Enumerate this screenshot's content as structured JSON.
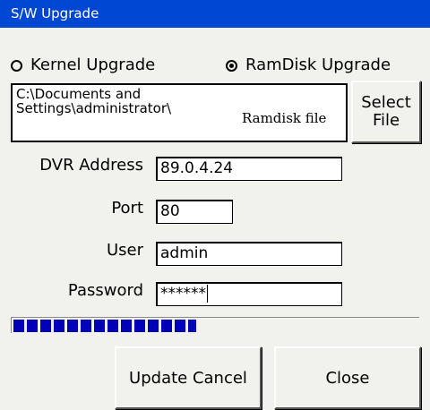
{
  "window": {
    "title": "S/W Upgrade"
  },
  "upgrade_type": {
    "kernel_label": "Kernel Upgrade",
    "ramdisk_label": "RamDisk Upgrade",
    "selected": "RamDisk Upgrade"
  },
  "file": {
    "path": "C:\\Documents and\nSettings\\administrator\\",
    "caption": "Ramdisk file",
    "select_label": "Select\nFile"
  },
  "form": {
    "dvr_address_label": "DVR Address",
    "dvr_address_value": "89.0.4.24",
    "port_label": "Port",
    "port_value": "80",
    "user_label": "User",
    "user_value": "admin",
    "password_label": "Password",
    "password_value": "******"
  },
  "progress": {
    "fraction": 0.45
  },
  "buttons": {
    "update_cancel": "Update Cancel",
    "close": "Close"
  },
  "colors": {
    "titlebar": "#0047d3",
    "progress": "#0000b8",
    "dialog_bg": "#f1f1ed"
  }
}
